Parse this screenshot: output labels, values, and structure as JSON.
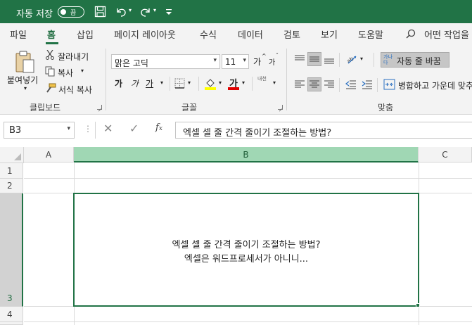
{
  "titlebar": {
    "autosave_label": "자동 저장",
    "toggle_state": "끔"
  },
  "tabs": [
    {
      "label": "파일"
    },
    {
      "label": "홈"
    },
    {
      "label": "삽입"
    },
    {
      "label": "페이지 레이아웃"
    },
    {
      "label": "수식"
    },
    {
      "label": "데이터"
    },
    {
      "label": "검토"
    },
    {
      "label": "보기"
    },
    {
      "label": "도움말"
    }
  ],
  "tell_me": "어떤 작업을",
  "clipboard": {
    "paste": "붙여넣기",
    "cut": "잘라내기",
    "copy": "복사",
    "format_painter": "서식 복사",
    "group": "클립보드"
  },
  "font": {
    "name": "맑은 고딕",
    "size": "11",
    "grow": "가",
    "shrink": "가",
    "bold": "가",
    "italic": "가",
    "underline": "가",
    "font_color_letter": "가",
    "phonetic": "내천",
    "group": "글꼴",
    "highlight_color": "#ffff00",
    "font_color": "#e00000"
  },
  "alignment": {
    "wrap_text": "자동 줄 바꿈",
    "merge_center": "병합하고 가운데 맞추",
    "group": "맞춤"
  },
  "formula_bar": {
    "name_box": "B3",
    "content": "엑셀 셀 줄 간격 줄이기 조절하는 방법?"
  },
  "grid": {
    "columns": [
      "A",
      "B",
      "C"
    ],
    "rows": [
      "1",
      "2",
      "3",
      "4"
    ],
    "selected_cell": "B3",
    "cell_b3_line1": "엑셀 셀 줄 간격 줄이기 조절하는 방법?",
    "cell_b3_line2": "엑셀은 워드프로세서가 아니니..."
  },
  "colors": {
    "excel_green": "#217346",
    "selected_header": "#d2d2d2",
    "selected_col_header": "#a0d7b4"
  }
}
